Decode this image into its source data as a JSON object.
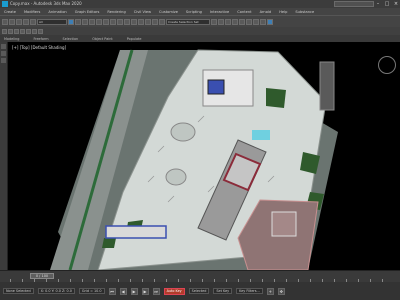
{
  "window": {
    "title": "Copy.max - Autodesk 3ds Max 2020"
  },
  "menu": [
    "Create",
    "Modifiers",
    "Animation",
    "Graph Editors",
    "Rendering",
    "Civil View",
    "Customize",
    "Scripting",
    "Interactive",
    "Content",
    "Arnold",
    "Help",
    "Substance"
  ],
  "toolbar": {
    "selection_filter": "All",
    "named_selection": "Create Selection Set"
  },
  "ribbon": {
    "tabs": [
      "Modeling",
      "Freeform",
      "Selection",
      "Object Paint",
      "Populate"
    ]
  },
  "viewport": {
    "label": "[+] [Top] [Default Shading]"
  },
  "timeline": {
    "frame": "0 / 100"
  },
  "status": {
    "selection": "None Selected",
    "coords": "X: 0.0  Y: 0.0  Z: 0.0",
    "grid": "Grid = 10.0",
    "autokey": "Auto Key",
    "selected": "Selected",
    "set_key": "Set Key",
    "key_filters": "Key Filters..."
  },
  "colors": {
    "ground": "#cfd6d2",
    "road": "#7c8582",
    "grass": "#2f5a2c",
    "building": "#b8b8b8"
  }
}
